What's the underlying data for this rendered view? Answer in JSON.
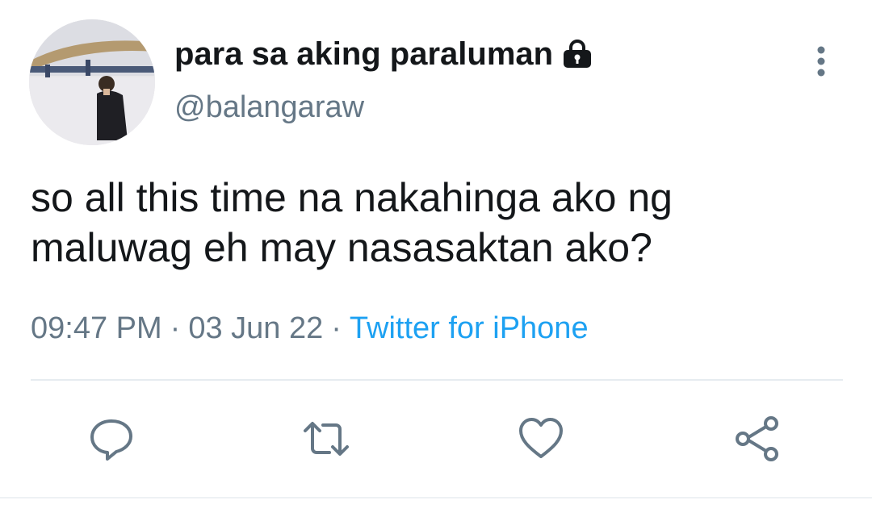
{
  "tweet": {
    "display_name": "para sa aking paraluman",
    "handle": "@balangaraw",
    "text_line1": "so all this time na nakahinga ako ng",
    "text_line2": "maluwag eh may nasasaktan ako?",
    "time": "09:47 PM",
    "separator": "·",
    "date": "03 Jun 22",
    "source": "Twitter for iPhone"
  },
  "icons": {
    "protected": "lock-icon",
    "more": "more-vertical-icon",
    "reply": "reply-icon",
    "retweet": "retweet-icon",
    "like": "heart-icon",
    "share": "share-icon"
  },
  "colors": {
    "text": "#14171a",
    "secondary": "#657786",
    "link": "#1da1f2",
    "divider": "#e6ecf0"
  }
}
